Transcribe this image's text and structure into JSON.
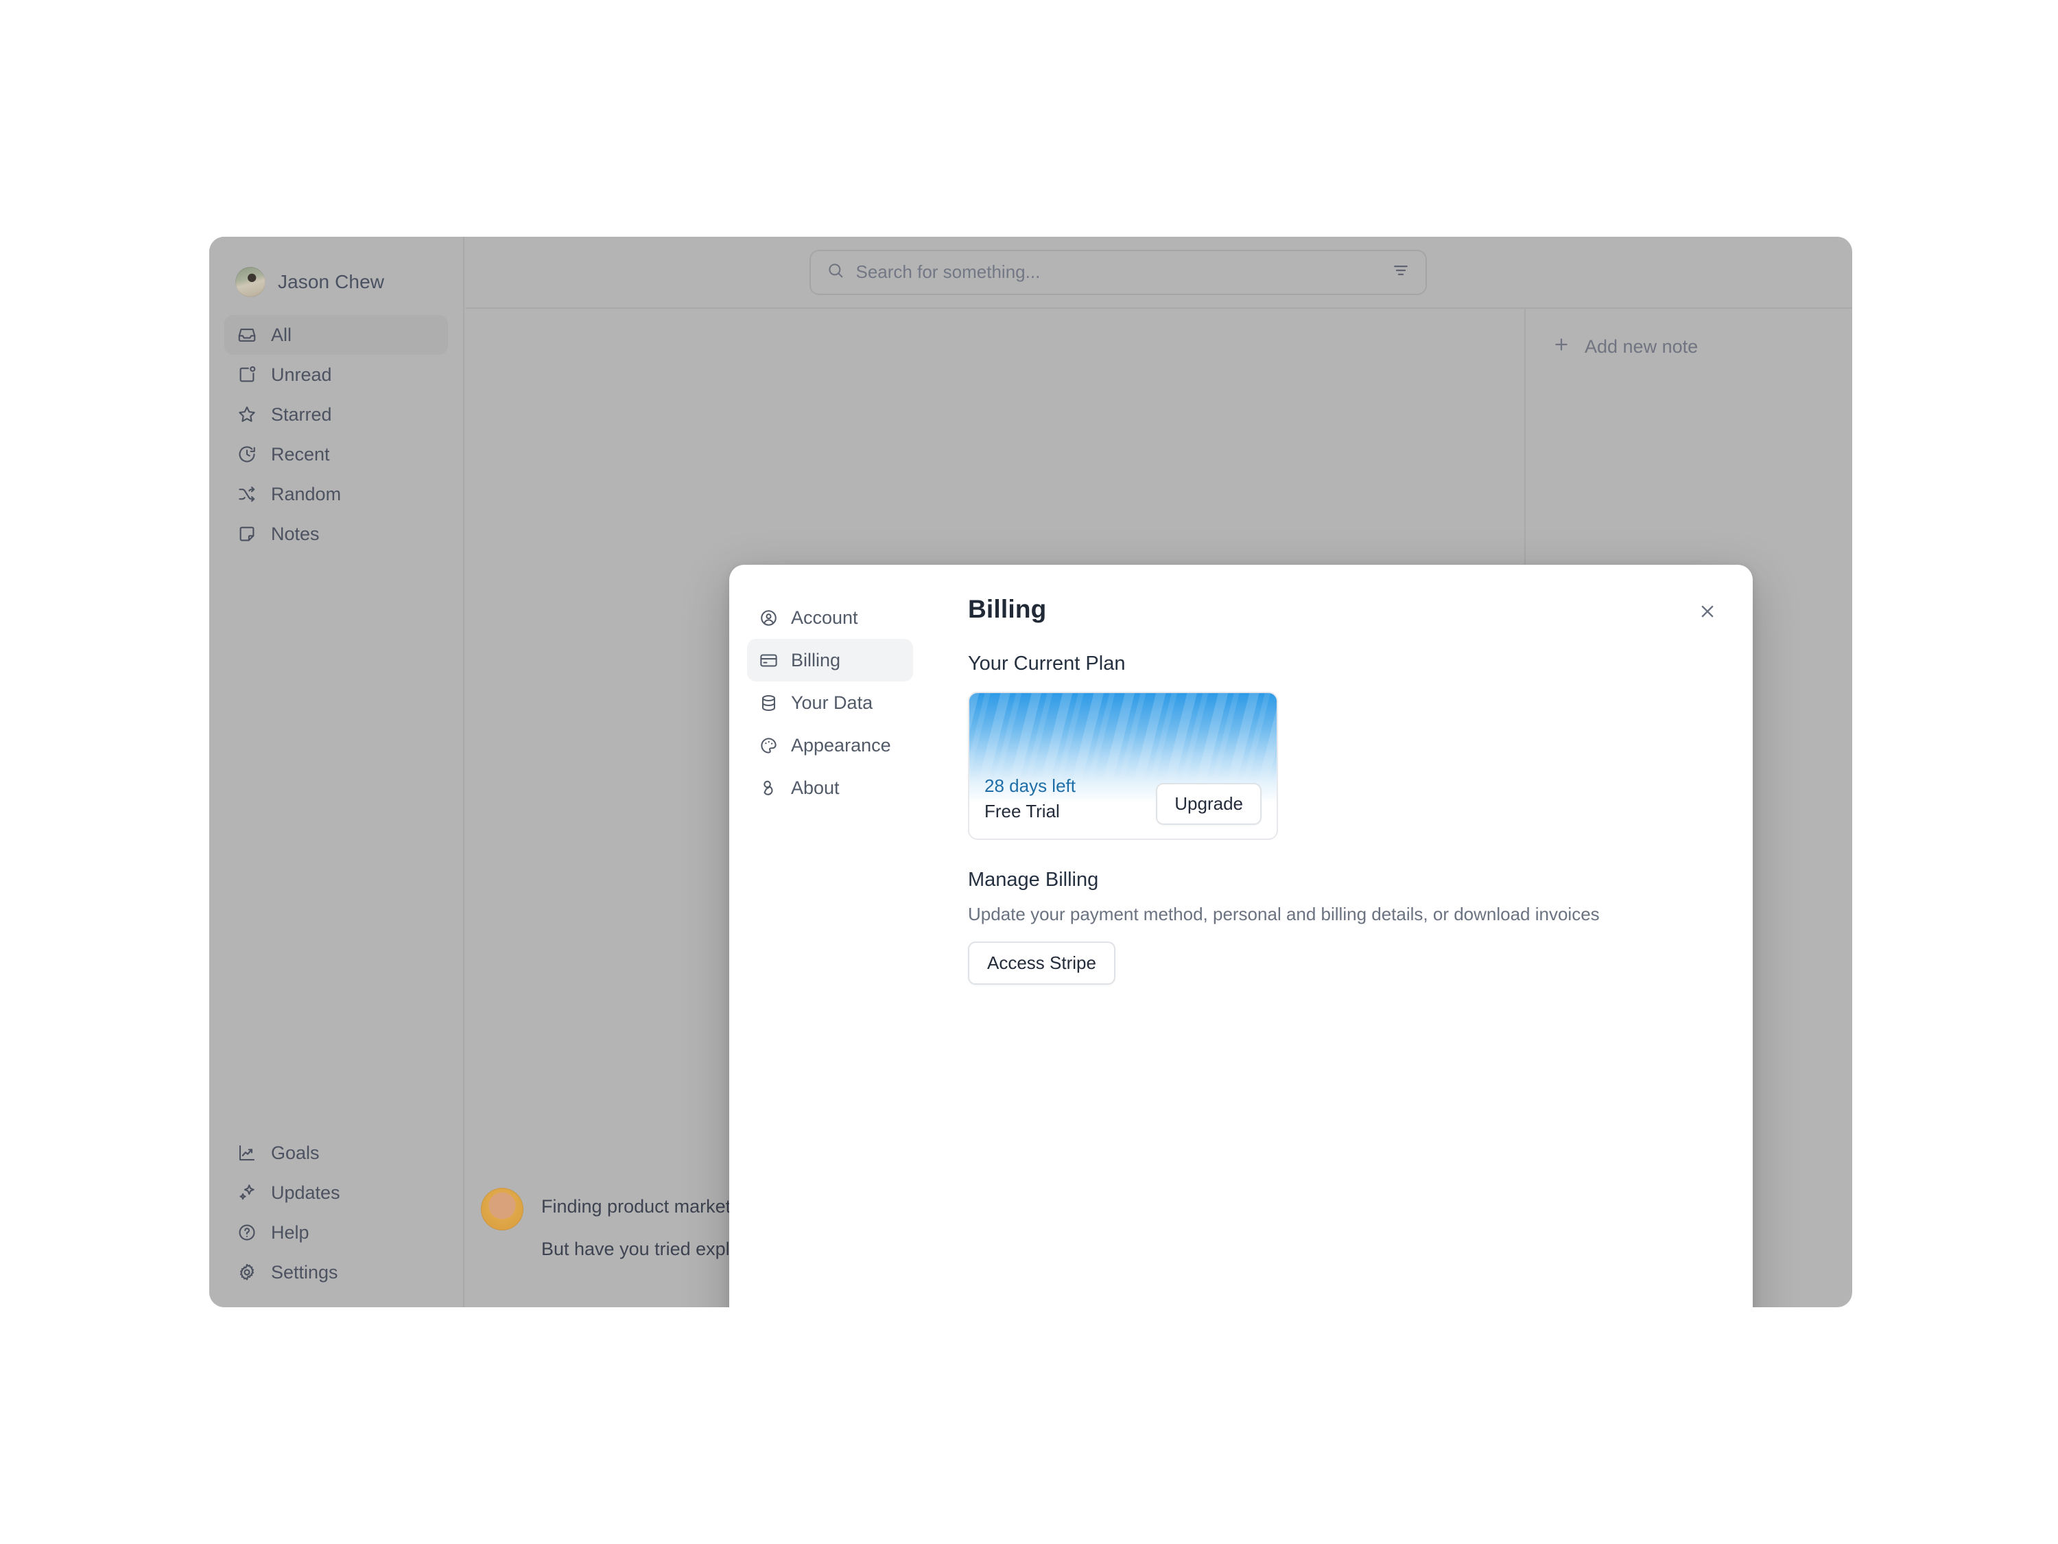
{
  "app": {
    "profile_name": "Jason Chew",
    "sidebar": {
      "primary_items": [
        {
          "label": "All",
          "icon": "inbox-icon"
        },
        {
          "label": "Unread",
          "icon": "unread-icon"
        },
        {
          "label": "Starred",
          "icon": "star-icon"
        },
        {
          "label": "Recent",
          "icon": "clock-icon"
        },
        {
          "label": "Random",
          "icon": "shuffle-icon"
        },
        {
          "label": "Notes",
          "icon": "note-icon"
        }
      ],
      "bottom_items": [
        {
          "label": "Goals",
          "icon": "chart-line-icon"
        },
        {
          "label": "Updates",
          "icon": "sparkles-icon"
        },
        {
          "label": "Help",
          "icon": "question-circle-icon"
        },
        {
          "label": "Settings",
          "icon": "gear-icon"
        }
      ]
    },
    "search": {
      "placeholder": "Search for something...",
      "value": "",
      "icon": "search-icon",
      "filter_icon": "filter-icon"
    },
    "list_pane": {
      "add_note_label": "Add new note",
      "add_icon": "plus-icon"
    },
    "background_note": {
      "line1": "Finding product market fit is hard...",
      "line2": "But have you tried explaining what we do to family"
    }
  },
  "modal": {
    "title": "Billing",
    "close_icon": "close-icon",
    "nav": [
      {
        "label": "Account",
        "icon": "user-circle-icon"
      },
      {
        "label": "Billing",
        "icon": "credit-card-icon"
      },
      {
        "label": "Your Data",
        "icon": "database-icon"
      },
      {
        "label": "Appearance",
        "icon": "palette-icon"
      },
      {
        "label": "About",
        "icon": "logo-icon"
      }
    ],
    "current_plan": {
      "heading": "Your Current Plan",
      "days_left": "28 days left",
      "plan_name": "Free Trial",
      "upgrade_label": "Upgrade",
      "accent_color": "#2e9ae6",
      "days_text_color": "#1f6ea8"
    },
    "manage_billing": {
      "heading": "Manage Billing",
      "description": "Update your payment method, personal and billing details, or download invoices",
      "button_label": "Access Stripe"
    }
  }
}
